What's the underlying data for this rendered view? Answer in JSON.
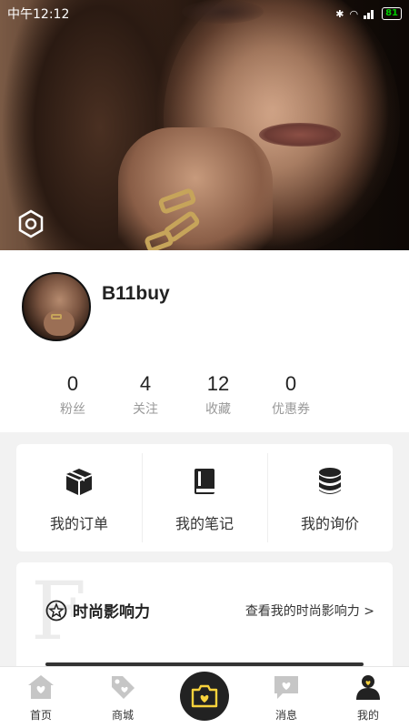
{
  "status_bar": {
    "time": "中午12:12",
    "battery": "81",
    "icons": [
      "bluetooth-icon",
      "wifi-icon",
      "signal-icon",
      "battery-icon"
    ]
  },
  "hero": {
    "settings_icon": "hexagon-settings-icon"
  },
  "profile": {
    "username": "B11buy",
    "stats": [
      {
        "value": "0",
        "label": "粉丝"
      },
      {
        "value": "4",
        "label": "关注"
      },
      {
        "value": "12",
        "label": "收藏"
      },
      {
        "value": "0",
        "label": "优惠券"
      }
    ]
  },
  "shortcuts": [
    {
      "label": "我的订单",
      "icon": "box-icon"
    },
    {
      "label": "我的笔记",
      "icon": "book-icon"
    },
    {
      "label": "我的询价",
      "icon": "coins-icon"
    }
  ],
  "influence": {
    "watermark": "F",
    "title": "时尚影响力",
    "link": "查看我的时尚影响力 >"
  },
  "bottom_nav": [
    {
      "label": "首页",
      "icon": "home-icon"
    },
    {
      "label": "商城",
      "icon": "tag-icon"
    },
    {
      "label": "",
      "icon": "camera-icon"
    },
    {
      "label": "消息",
      "icon": "message-icon"
    },
    {
      "label": "我的",
      "icon": "user-icon"
    }
  ],
  "colors": {
    "accent": "#f7d23c",
    "icon_gray": "#c6c6c6",
    "dark": "#222222"
  }
}
